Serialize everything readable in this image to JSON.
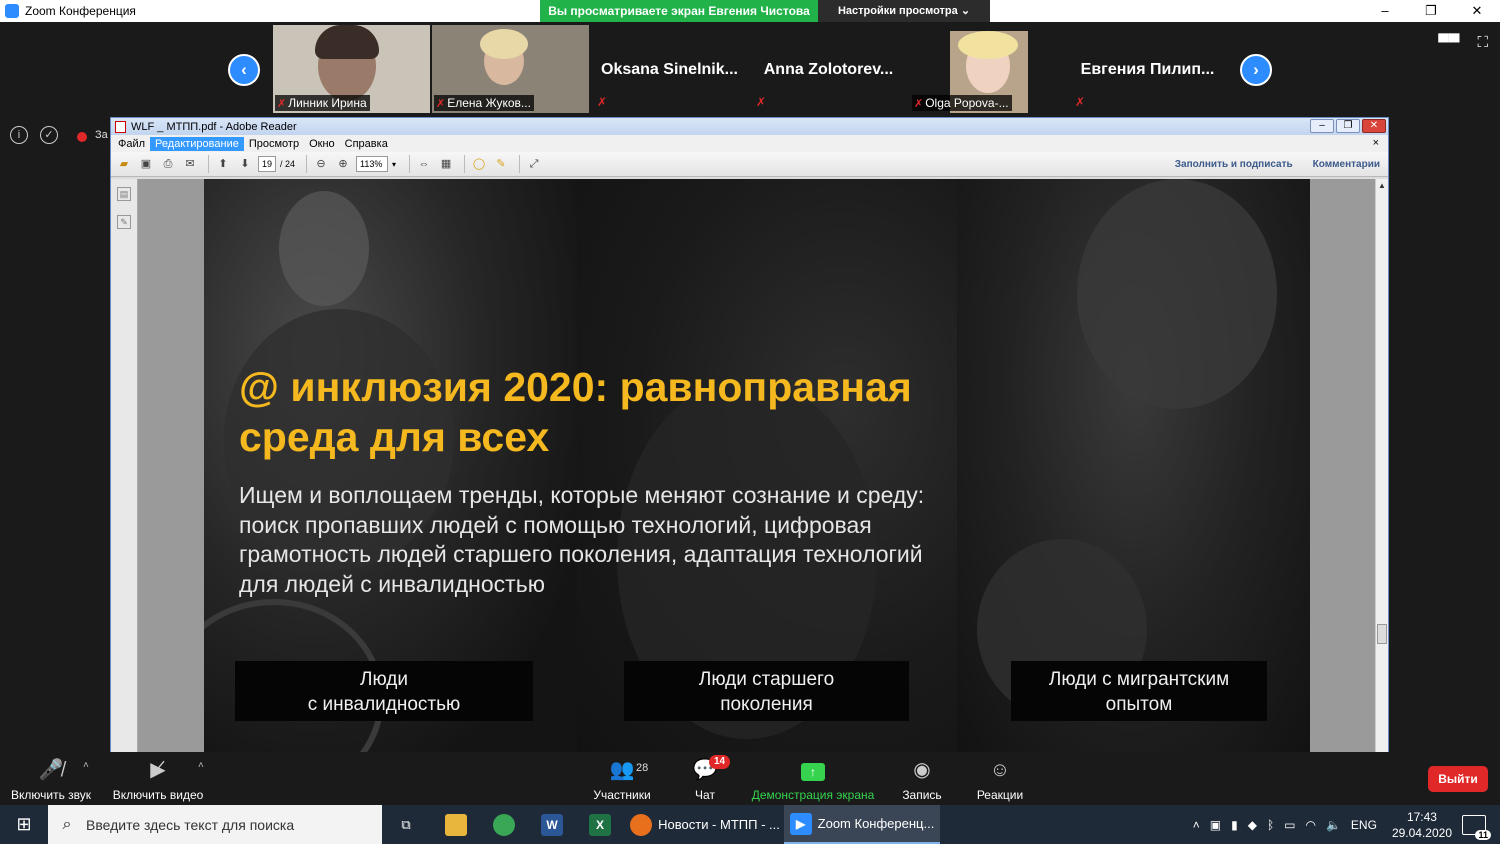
{
  "zoom": {
    "window_title": "Zoom Конференция",
    "window_controls": [
      "–",
      "❐",
      "✕"
    ],
    "share_banner": "Вы просматриваете экран Евгения Чистова",
    "view_options": "Настройки просмотра ⌄",
    "recording_label": "За",
    "participants": [
      {
        "name": "Линник Ирина",
        "video": true
      },
      {
        "name": "Елена Жуков...",
        "video": true
      },
      {
        "name": "Oksana  Sinelnik...",
        "video": false
      },
      {
        "name": "Anna  Zolotorev...",
        "video": false
      },
      {
        "name": "Olga Popova-...",
        "video": true
      },
      {
        "name": "Евгения  Пилип...",
        "video": false
      }
    ],
    "controls": {
      "unmute": "Включить звук",
      "start_video": "Включить видео",
      "participants": "Участники",
      "participants_count": "28",
      "chat": "Чат",
      "chat_badge": "14",
      "share": "Демонстрация экрана",
      "record": "Запись",
      "reactions": "Реакции",
      "leave": "Выйти"
    }
  },
  "reader": {
    "title": "WLF _ МТПП.pdf - Adobe Reader",
    "menu": [
      "Файл",
      "Редактирование",
      "Просмотр",
      "Окно",
      "Справка"
    ],
    "active_menu_index": 1,
    "page_current": "19",
    "page_total": "/ 24",
    "zoom": "113%",
    "fill_sign": "Заполнить и подписать",
    "comments": "Комментарии"
  },
  "slide": {
    "title_line1": "@ инклюзия 2020: равноправная",
    "title_line2": "среда для всех",
    "body_line1": "Ищем и воплощаем тренды, которые меняют сознание и среду:",
    "body_line2": "поиск пропавших людей с помощью технологий, цифровая",
    "body_line3": "грамотность людей старшего поколения, адаптация технологий",
    "body_line4": "для людей с инвалидностью",
    "boxes": [
      "Люди\nс инвалидностью",
      "Люди старшего\nпоколения",
      "Люди с мигрантским\nопытом"
    ],
    "title_color": "#f5b91f"
  },
  "taskbar": {
    "search_placeholder": "Введите здесь текст для поиска",
    "firefox_label": "Новости - МТПП - ...",
    "zoom_label": "Zoom Конференц...",
    "lang": "ENG",
    "time": "17:43",
    "date": "29.04.2020",
    "notifications": "11"
  }
}
